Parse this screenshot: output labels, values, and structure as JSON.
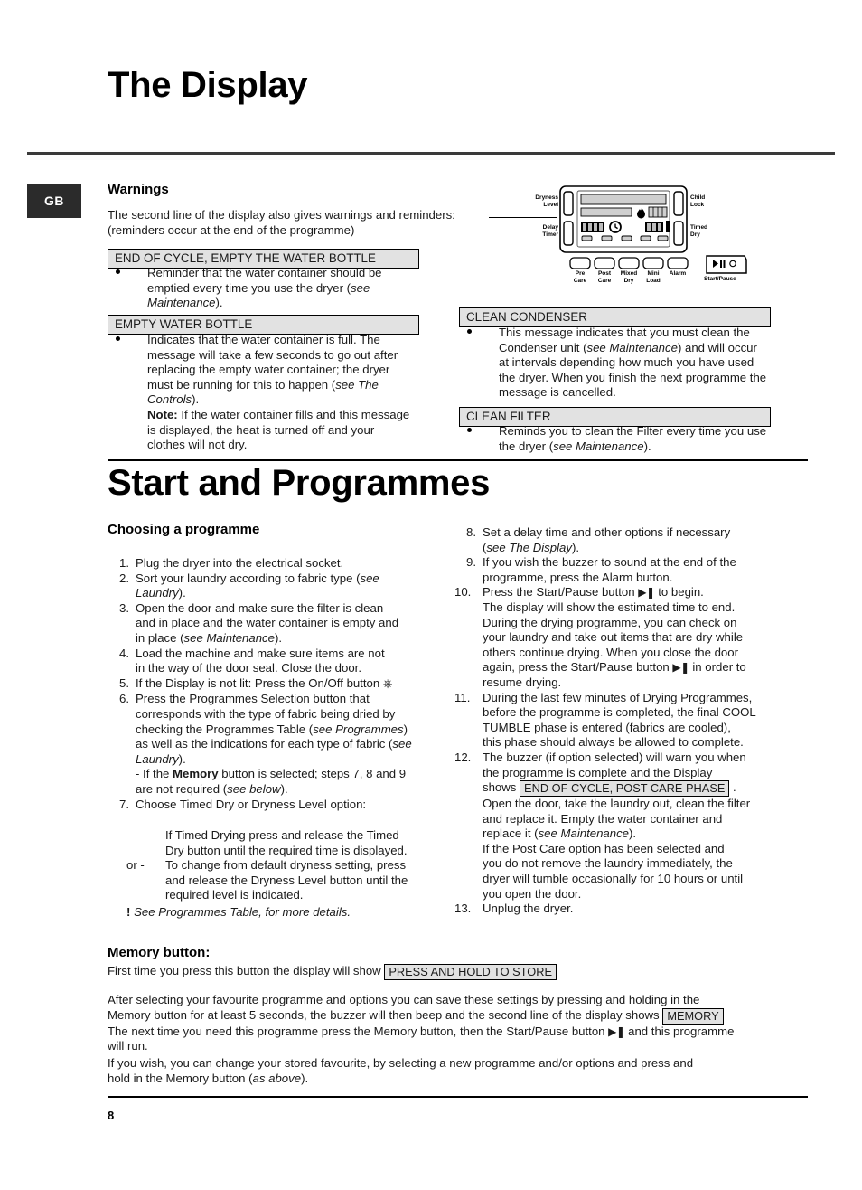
{
  "page": {
    "number": "8",
    "locale_tab": "GB"
  },
  "section_display": {
    "title": "The Display",
    "warnings_heading": "Warnings",
    "intro_line1": "The second line of the display also gives warnings and reminders:",
    "intro_line2": "(reminders occur at the end of the programme)",
    "messages": [
      {
        "label": "END OF CYCLE, EMPTY THE WATER BOTTLE",
        "body_line1": "Reminder that the water container should be",
        "body_line2_a": "emptied every time you use the dryer (",
        "body_line2_i": "see",
        "body_line3_i": "Maintenance",
        "body_line3_b": ")."
      },
      {
        "label": "EMPTY WATER BOTTLE",
        "l1": "Indicates that the water container is full. The",
        "l2": "message will take a few seconds to go out after",
        "l3": "replacing the empty water container; the dryer",
        "l4a": "must be running for this to happen (",
        "l4i": "see The",
        "l5i": "Controls",
        "l5b": ").",
        "note_label": "Note:",
        "note_l1": " If the water container fills and this message",
        "note_l2": "is displayed, the heat is turned off and your",
        "note_l3": "clothes will not dry."
      },
      {
        "label": "CLEAN CONDENSER",
        "l1": "This message indicates that you must clean the",
        "l2a": "Condenser unit (",
        "l2i": "see Maintenance",
        "l2b": ") and will occur",
        "l3": "at intervals depending how much you have used",
        "l4": "the dryer. When you finish the next programme the",
        "l5": "message is cancelled."
      },
      {
        "label": "CLEAN FILTER",
        "l1": "Reminds you to clean the Filter every time you use",
        "l2a": "the dryer (",
        "l2i": "see Maintenance",
        "l2b": ")."
      }
    ]
  },
  "panel": {
    "labels_left": [
      {
        "line1": "Dryness",
        "line2": "Level"
      },
      {
        "line1": "Delay",
        "line2": "Timer"
      }
    ],
    "labels_right": [
      {
        "line1": "Child",
        "line2": "Lock"
      },
      {
        "line1": "Timed",
        "line2": "Dry"
      }
    ],
    "option_buttons": [
      {
        "line1": "Pre",
        "line2": "Care"
      },
      {
        "line1": "Post",
        "line2": "Care"
      },
      {
        "line1": "Mixed",
        "line2": "Dry"
      },
      {
        "line1": "Mini",
        "line2": "Load"
      },
      {
        "line1": "Alarm",
        "line2": ""
      }
    ],
    "start_pause_label": "Start/Pause",
    "start_pause_glyph": "▶❚",
    "segment_display_left": "88:88",
    "segment_display_right": "888"
  },
  "section_start": {
    "title": "Start and Programmes",
    "subheading": "Choosing a programme",
    "steps_left": [
      {
        "n": "1.",
        "lines": [
          {
            "t": "Plug the dryer into the electrical socket."
          }
        ]
      },
      {
        "n": "2.",
        "lines": [
          {
            "t": "Sort your laundry according to fabric type (",
            "i": "see"
          },
          {
            "i": "Laundry",
            "t2": ")."
          }
        ]
      },
      {
        "n": "3.",
        "lines": [
          {
            "t": "Open the door and make sure the filter is clean"
          },
          {
            "t": "and in place and the water container is empty and"
          },
          {
            "t": "in place (",
            "i": "see Maintenance",
            "t2": ")."
          }
        ]
      },
      {
        "n": "4.",
        "lines": [
          {
            "t": "Load the machine and make sure items are not"
          },
          {
            "t": "in the way of the door seal. Close the door."
          }
        ]
      },
      {
        "n": "5.",
        "lines": [
          {
            "t": "If the Display is not lit: Press the On/Off button"
          }
        ]
      },
      {
        "n": "6.",
        "lines": [
          {
            "t": "Press the Programmes Selection button that"
          },
          {
            "t": "corresponds with the type of fabric being dried by"
          },
          {
            "t": "checking the Programmes Table (",
            "i": "see Programmes",
            "t2": ")"
          },
          {
            "t": "as well as the indications for each type of fabric (",
            "i": "see"
          },
          {
            "i": "Laundry",
            "t2": ")."
          },
          {
            "t": "- If the ",
            "b": "Memory",
            "t2": " button is selected; steps 7, 8 and 9"
          },
          {
            "t": "are not required (",
            "i": "see below",
            "t2": ")."
          }
        ]
      },
      {
        "n": "7.",
        "lines": [
          {
            "t": "Choose Timed Dry or Dryness Level option:"
          }
        ]
      }
    ],
    "step7_sub": {
      "dash": "-",
      "l1": "If Timed Drying press and release the Timed",
      "l2": "Dry button until the required time is displayed.",
      "or_prefix": "or -",
      "l3": "To change from default dryness setting, press",
      "l4": "and release the Dryness Level button until the",
      "l5": "required level is indicated."
    },
    "note_bang": "!",
    "note_text": "See Programmes Table, for more details.",
    "steps_right": [
      {
        "n": "8.",
        "lines": [
          {
            "t": "Set a delay time and other options if necessary"
          },
          {
            "t": "(",
            "i": "see The Display",
            "t2": ")."
          }
        ]
      },
      {
        "n": "9.",
        "lines": [
          {
            "t": "If you wish the buzzer to sound at the end of the"
          },
          {
            "t": "programme, press the Alarm button."
          }
        ]
      },
      {
        "n": "10.",
        "lines": [
          {
            "t": "Press the Start/Pause button ",
            "glyph": "▶❚",
            "t2": " to begin."
          },
          {
            "t": "The display will show the estimated time to end."
          },
          {
            "t": "During the drying programme, you can check on"
          },
          {
            "t": "your laundry and take out items that are dry while"
          },
          {
            "t": "others continue drying. When you close the door"
          },
          {
            "t": "again, press the Start/Pause button ",
            "glyph": "▶❚",
            "t2": " in order to"
          },
          {
            "t": "resume drying."
          }
        ]
      },
      {
        "n": "11.",
        "lines": [
          {
            "t": "During the last few minutes of Drying Programmes,"
          },
          {
            "t": "before the programme is completed, the final COOL"
          },
          {
            "t": "TUMBLE phase is entered (fabrics are cooled),"
          },
          {
            "t": "this phase should always be allowed to complete."
          }
        ]
      },
      {
        "n": "12.",
        "lines": [
          {
            "t": "The buzzer (if option selected) will warn you when"
          },
          {
            "t": "the programme is complete and the Display"
          },
          {
            "t": "shows ",
            "box": "END OF CYCLE, POST CARE PHASE",
            "t2": " ."
          },
          {
            "t": "Open the door, take the laundry out, clean the filter"
          },
          {
            "t": "and replace it. Empty the water container and"
          },
          {
            "t": "replace it (",
            "i": "see Maintenance",
            "t2": ")."
          },
          {
            "t": "If the Post Care option has been selected and"
          },
          {
            "t": "you do not remove the laundry immediately, the"
          },
          {
            "t": "dryer will tumble occasionally for 10 hours or until"
          },
          {
            "t": "you open the door."
          }
        ]
      },
      {
        "n": "13.",
        "lines": [
          {
            "t": "Unplug the dryer."
          }
        ]
      }
    ]
  },
  "memory": {
    "heading": "Memory button:",
    "line1_pre": "First time you press this button the display will show",
    "line1_box": "PRESS AND HOLD TO STORE",
    "p2_l1": "After selecting your favourite programme and options you can save these settings by pressing and holding in the",
    "p2_l2_pre": "Memory button for at least 5 seconds, the buzzer will then beep and the second line of the display shows",
    "p2_l2_box": "MEMORY",
    "p2_l3_pre": "The next time you need this programme press the Memory button, then the Start/Pause button ",
    "p2_l3_glyph": "▶❚",
    "p2_l3_post": " and this programme",
    "p2_l4": "will run.",
    "p3_l1": "If you wish, you can change your stored favourite, by selecting a new programme and/or options and press and",
    "p3_l2_pre": "hold in the Memory button (",
    "p3_l2_i": "as above",
    "p3_l2_post": ")."
  },
  "colors": {
    "rule": "#3a3a3a",
    "tab_bg": "#2b2b2b",
    "msgbox_bg": "#e2e2e2",
    "text": "#1a1a1a"
  }
}
